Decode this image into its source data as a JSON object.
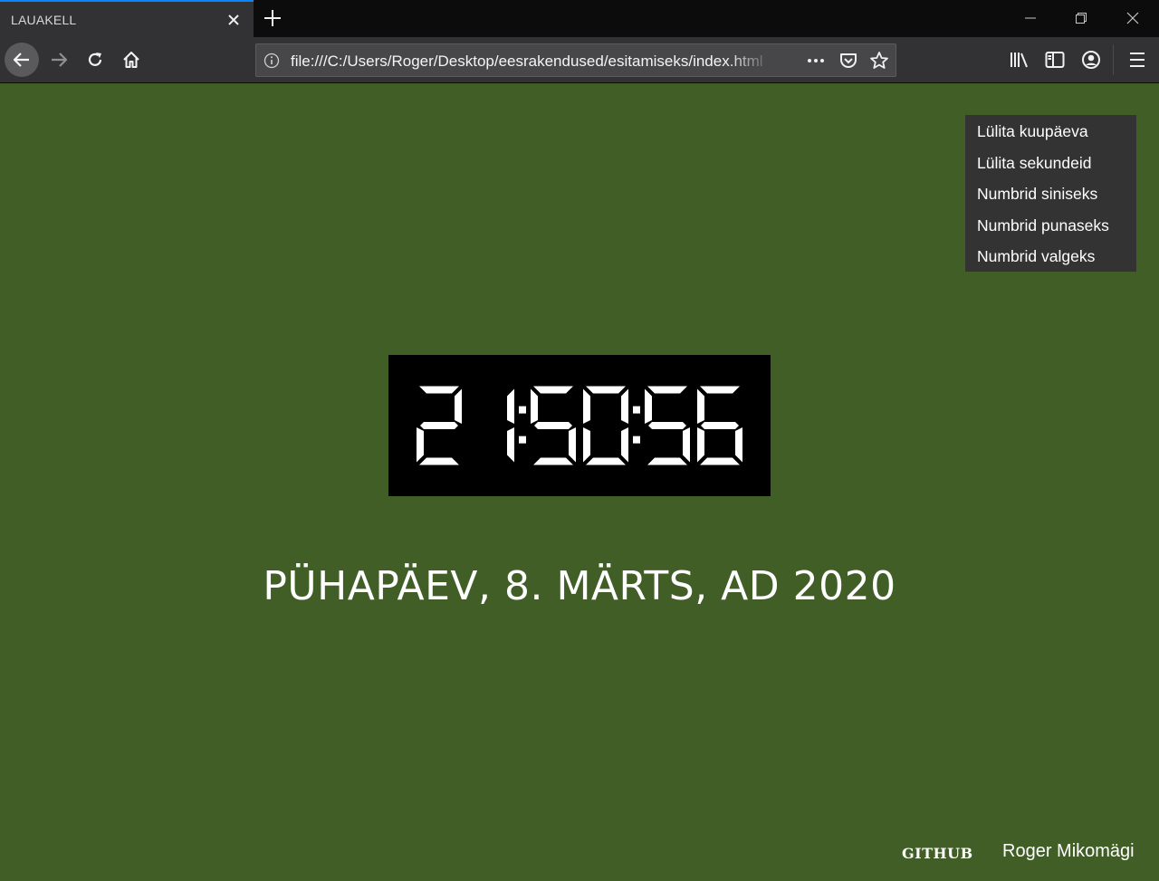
{
  "browser": {
    "tab_title": "LAUAKELL",
    "url": "file:///C:/Users/Roger/Desktop/eesrakendused/esitamiseks/index.html",
    "icons": {
      "tab_close": "close-icon",
      "new_tab": "plus-icon",
      "back": "arrow-left-icon",
      "forward": "arrow-right-icon",
      "reload": "reload-icon",
      "home": "home-icon",
      "info": "info-icon",
      "page_actions": "more-horizontal-icon",
      "pocket": "pocket-icon",
      "bookmark": "star-icon",
      "library": "library-icon",
      "sidebar": "sidebar-icon",
      "account": "account-icon",
      "menu": "hamburger-icon"
    }
  },
  "menu": {
    "items": [
      "Lülita kuupäeva",
      "Lülita sekundeid",
      "Numbrid siniseks",
      "Numbrid punaseks",
      "Numbrid valgeks"
    ]
  },
  "clock": {
    "time": "21:50:56",
    "digit_color": "#ffffff",
    "background": "#000000"
  },
  "date": "PÜHAPÄEV, 8. MÄRTS, AD 2020",
  "footer": {
    "link": "GITHUB",
    "author": "Roger Mikomägi"
  },
  "colors": {
    "page_background": "#405e26",
    "menu_background": "#333333",
    "tab_accent": "#0a84ff"
  }
}
